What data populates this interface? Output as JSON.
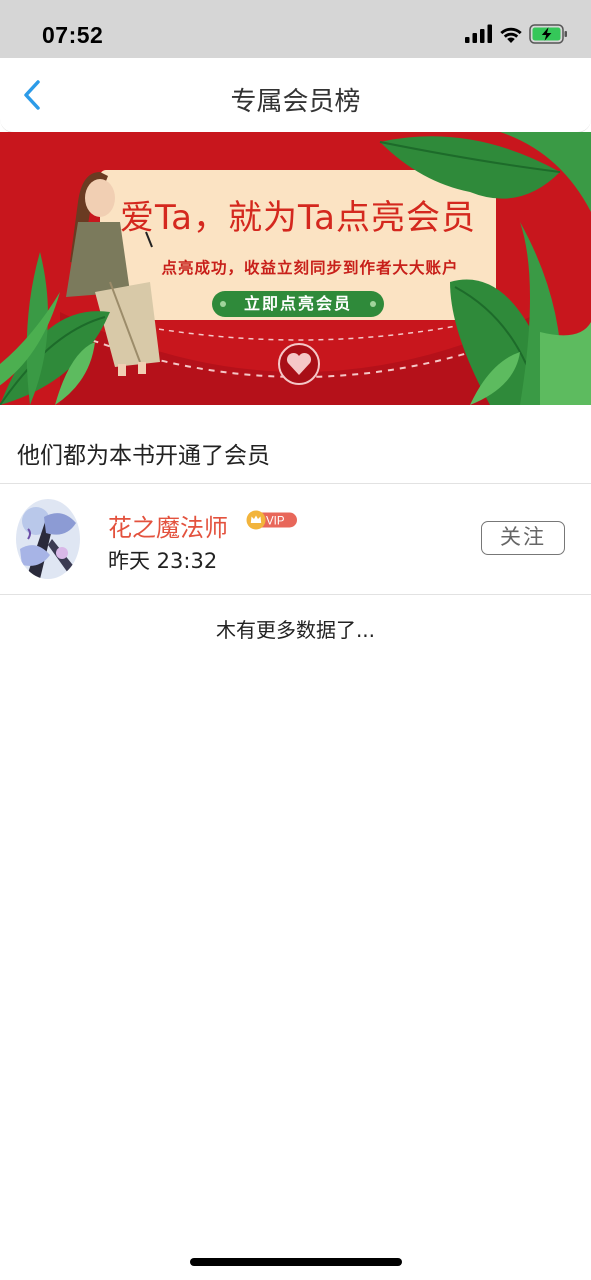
{
  "status_bar": {
    "time": "07:52",
    "icons": [
      "signal-icon",
      "wifi-icon",
      "battery-charging-icon"
    ]
  },
  "nav": {
    "title": "专属会员榜",
    "back_icon": "chevron-left-icon"
  },
  "banner": {
    "headline": "爱Ta，就为Ta点亮会员",
    "subtitle": "点亮成功，收益立刻同步到作者大大账户",
    "cta_label": "立即点亮会员",
    "colors": {
      "background": "#c8161d",
      "paper": "#fbe3c3",
      "leaf": "#2f8a3a",
      "text": "#d4281e"
    }
  },
  "section": {
    "title": "他们都为本书开通了会员"
  },
  "members": [
    {
      "name": "花之魔法师",
      "badge": "VIP",
      "time": "昨天 23:32",
      "follow_label": "关注"
    }
  ],
  "list_end_text": "木有更多数据了...",
  "colors": {
    "accent": "#2c9be8",
    "name": "#e3523e",
    "vip": "#e8a23a"
  }
}
